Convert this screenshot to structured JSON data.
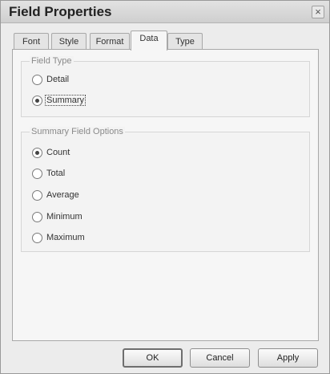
{
  "window": {
    "title": "Field Properties",
    "close_glyph": "×"
  },
  "tabs": [
    {
      "label": "Font",
      "active": false
    },
    {
      "label": "Style",
      "active": false
    },
    {
      "label": "Format",
      "active": false
    },
    {
      "label": "Data",
      "active": true
    },
    {
      "label": "Type",
      "active": false
    }
  ],
  "field_type": {
    "title": "Field Type",
    "options": [
      {
        "label": "Detail",
        "selected": false
      },
      {
        "label": "Summary",
        "selected": true
      }
    ]
  },
  "summary_options": {
    "title": "Summary Field Options",
    "options": [
      {
        "label": "Count",
        "selected": true
      },
      {
        "label": "Total",
        "selected": false
      },
      {
        "label": "Average",
        "selected": false
      },
      {
        "label": "Minimum",
        "selected": false
      },
      {
        "label": "Maximum",
        "selected": false
      }
    ]
  },
  "buttons": {
    "ok": "OK",
    "cancel": "Cancel",
    "apply": "Apply"
  }
}
